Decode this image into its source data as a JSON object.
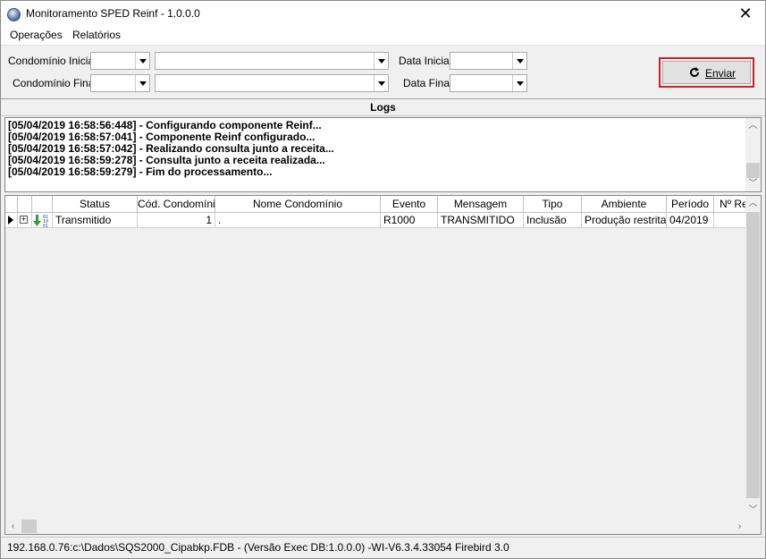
{
  "window": {
    "title": "Monitoramento SPED Reinf - 1.0.0.0",
    "close": "✕"
  },
  "menu": {
    "items": [
      "Operações",
      "Relatórios"
    ]
  },
  "filters": {
    "condominio_inicial": {
      "label": "Condomínio Inicial",
      "code": "",
      "name": ""
    },
    "condominio_final": {
      "label": "Condomínio Final",
      "code": "",
      "name": ""
    },
    "data_inicial": {
      "label": "Data Inicial",
      "value": ""
    },
    "data_final": {
      "label": "Data Final",
      "value": ""
    }
  },
  "send_button": {
    "label": "Enviar",
    "icon": "refresh-icon",
    "highlight_color": "#d0202c"
  },
  "logs": {
    "title": "Logs",
    "lines": [
      "[05/04/2019 16:58:56:448] - Configurando componente Reinf...",
      "[05/04/2019 16:58:57:041] - Componente Reinf configurado...",
      "[05/04/2019 16:58:57:042] - Realizando consulta junto a receita...",
      "[05/04/2019 16:58:59:278] - Consulta junto a receita realizada...",
      "[05/04/2019 16:58:59:279] - Fim do processamento..."
    ]
  },
  "grid": {
    "columns": [
      "Status",
      "Cód. Condomínio",
      "Nome Condomínio",
      "Evento",
      "Mensagem",
      "Tipo",
      "Ambiente",
      "Período",
      "Nº Re"
    ],
    "rows": [
      {
        "status_icon": "transmitted-icon",
        "status": "Transmitido",
        "cod": "1",
        "nome": ".",
        "evento": "R1000",
        "mensagem": "TRANSMITIDO",
        "tipo": "Inclusão",
        "ambiente": "Produção restrita",
        "periodo": "04/2019",
        "num": ""
      }
    ]
  },
  "status_bar": {
    "text": "192.168.0.76:c:\\Dados\\SQS2000_Cipabkp.FDB - (Versão Exec DB:1.0.0.0) -WI-V6.3.4.33054 Firebird 3.0"
  }
}
